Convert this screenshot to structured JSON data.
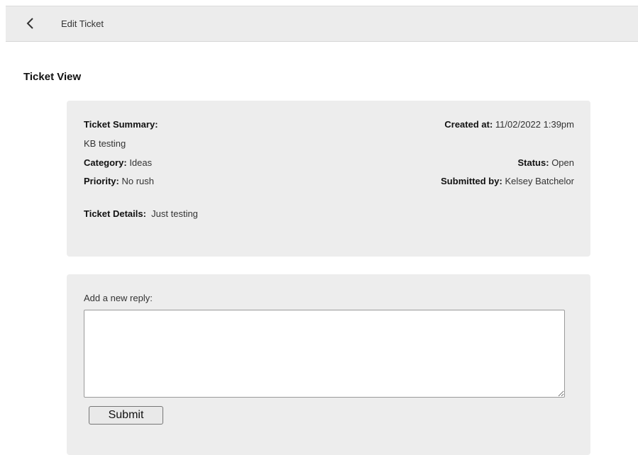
{
  "header": {
    "back_icon": "chevron-left-icon",
    "title": "Edit Ticket"
  },
  "page": {
    "heading": "Ticket View"
  },
  "ticket": {
    "summary_label": "Ticket Summary:",
    "summary_value": "KB testing",
    "category_label": "Category:",
    "category_value": "Ideas",
    "priority_label": "Priority:",
    "priority_value": "No rush",
    "details_label": "Ticket Details:",
    "details_value": "Just testing",
    "created_label": "Created at:",
    "created_value": "11/02/2022 1:39pm",
    "status_label": "Status:",
    "status_value": "Open",
    "submitted_label": "Submitted by:",
    "submitted_value": "Kelsey Batchelor"
  },
  "reply": {
    "label": "Add a new reply:",
    "textarea_value": "",
    "submit_label": "Submit"
  },
  "colors": {
    "topbar_bg": "#ececec",
    "card_bg": "#ededed",
    "page_bg": "#ffffff"
  }
}
